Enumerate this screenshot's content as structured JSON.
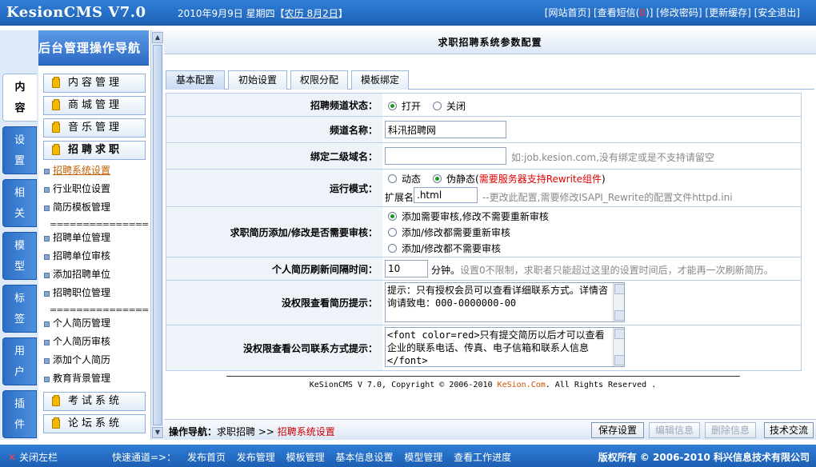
{
  "top": {
    "logo": "KesionCMS V7.0",
    "date": "2010年9月9日 星期四【",
    "lunar": "农历 8月2日",
    "date_end": "】",
    "links": [
      "[网站首页]",
      "[查看短信(",
      ")]",
      "[修改密码]",
      "[更新缓存]",
      "[安全退出]"
    ],
    "msg_count": "0"
  },
  "nav": {
    "title": "后台管理操作导航",
    "side_tabs": [
      {
        "l1": "内",
        "l2": "容"
      },
      {
        "l1": "设",
        "l2": "置"
      },
      {
        "l1": "相",
        "l2": "关"
      },
      {
        "l1": "模",
        "l2": "型"
      },
      {
        "l1": "标",
        "l2": "签"
      },
      {
        "l1": "用",
        "l2": "户"
      },
      {
        "l1": "插",
        "l2": "件"
      }
    ],
    "menus": [
      "内容管理",
      "商城管理",
      "音乐管理",
      "招聘求职",
      "考试系统",
      "论坛系统"
    ],
    "sub_a": [
      "招聘系统设置",
      "行业职位设置",
      "简历模板管理"
    ],
    "sub_b": [
      "招聘单位管理",
      "招聘单位审核",
      "添加招聘单位",
      "招聘职位管理"
    ],
    "sub_c": [
      "个人简历管理",
      "个人简历审核",
      "添加个人简历",
      "教育背景管理"
    ],
    "separator": "=================="
  },
  "main": {
    "header": "求职招聘系统参数配置",
    "tabs": [
      "基本配置",
      "初始设置",
      "权限分配",
      "模板绑定"
    ],
    "rows": {
      "status": {
        "label": "招聘频道状态：",
        "opt1": "打开",
        "opt2": "关闭"
      },
      "name": {
        "label": "频道名称：",
        "value": "科汛招聘网"
      },
      "domain": {
        "label": "绑定二级域名：",
        "value": "",
        "hint": "如:job.kesion.com,没有绑定或是不支持请留空"
      },
      "mode": {
        "label": "运行模式：",
        "opt1": "动态",
        "opt2": "伪静态(",
        "opt2_red": "需要服务器支持Rewrite组件",
        "opt2_end": ")",
        "ext_label": "扩展名",
        "ext_value": ".html",
        "ext_hint": "--更改此配置,需要修改ISAPI_Rewrite的配置文件httpd.ini"
      },
      "audit": {
        "label": "求职简历添加/修改是否需要审核：",
        "opt1": "添加需要审核,修改不需要重新审核",
        "opt2": "添加/修改都需要重新审核",
        "opt3": "添加/修改都不需要审核"
      },
      "refresh": {
        "label": "个人简历刷新间隔时间：",
        "value": "10",
        "unit": "分钟。",
        "hint": "设置0不限制，求职者只能超过这里的设置时间后，才能再一次刷新简历。"
      },
      "resume_tip": {
        "label": "没权限查看简历提示：",
        "value": "提示：只有授权会员可以查看详细联系方式。详情咨询请致电：000-0000000-00"
      },
      "contact_tip": {
        "label": "没权限查看公司联系方式提示：",
        "value": "<font color=red>只有提交简历以后才可以查看企业的联系电话、传真、电子信箱和联系人信息</font>"
      }
    },
    "copyright_a": "KeSionCMS V 7.0, Copyright © 2006-2010 ",
    "copyright_brand": "KeSion.Com",
    "copyright_b": ". All Rights Reserved ."
  },
  "bottom": {
    "nav_label": "操作导航：",
    "nav_path": "求职招聘 >> ",
    "nav_current": "招聘系统设置",
    "buttons": [
      "保存设置",
      "编辑信息",
      "删除信息",
      "技术交流"
    ]
  },
  "footer": {
    "close": "关闭左栏",
    "quick_label": "快速通道=>：",
    "quick": [
      "发布首页",
      "发布管理",
      "模板管理",
      "基本信息设置",
      "模型管理",
      "查看工作进度"
    ],
    "copy": "版权所有 © 2006-2010 科兴信息技术有限公司"
  }
}
